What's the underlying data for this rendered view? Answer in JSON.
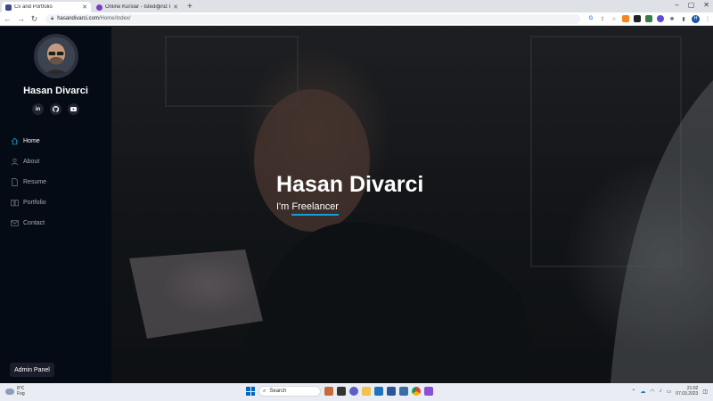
{
  "browser": {
    "tabs": [
      {
        "title": "Cv and Portfolio",
        "favicon_color": "#3b4a8a",
        "active": true
      },
      {
        "title": "Online Kurslar - İstediğiniz Her Şe",
        "favicon_color": "#7b3fbf",
        "active": false
      }
    ],
    "new_tab": "+",
    "url_host": "hasandivarci.com",
    "url_path": "/Home/Index/",
    "profile_initial": "H"
  },
  "sidebar": {
    "name": "Hasan Divarci",
    "socials": [
      {
        "label": "in",
        "icon": "linkedin-icon"
      },
      {
        "label": "gh",
        "icon": "github-icon"
      },
      {
        "label": "yt",
        "icon": "youtube-icon"
      }
    ],
    "nav": [
      {
        "label": "Home",
        "icon": "home-icon",
        "active": true
      },
      {
        "label": "About",
        "icon": "user-icon",
        "active": false
      },
      {
        "label": "Resume",
        "icon": "file-icon",
        "active": false
      },
      {
        "label": "Portfolio",
        "icon": "book-icon",
        "active": false
      },
      {
        "label": "Contact",
        "icon": "envelope-icon",
        "active": false
      }
    ],
    "admin_label": "Admin Panel"
  },
  "hero": {
    "title": "Hasan Divarci",
    "subtitle_prefix": "I'm ",
    "subtitle_keyword": "Freelancer"
  },
  "taskbar": {
    "weather_temp": "8°C",
    "weather_desc": "Fog",
    "search_label": "Search",
    "time": "21:02",
    "date": "07.03.2023"
  },
  "colors": {
    "sidebar_bg": "#040b14",
    "accent": "#149ddd"
  }
}
